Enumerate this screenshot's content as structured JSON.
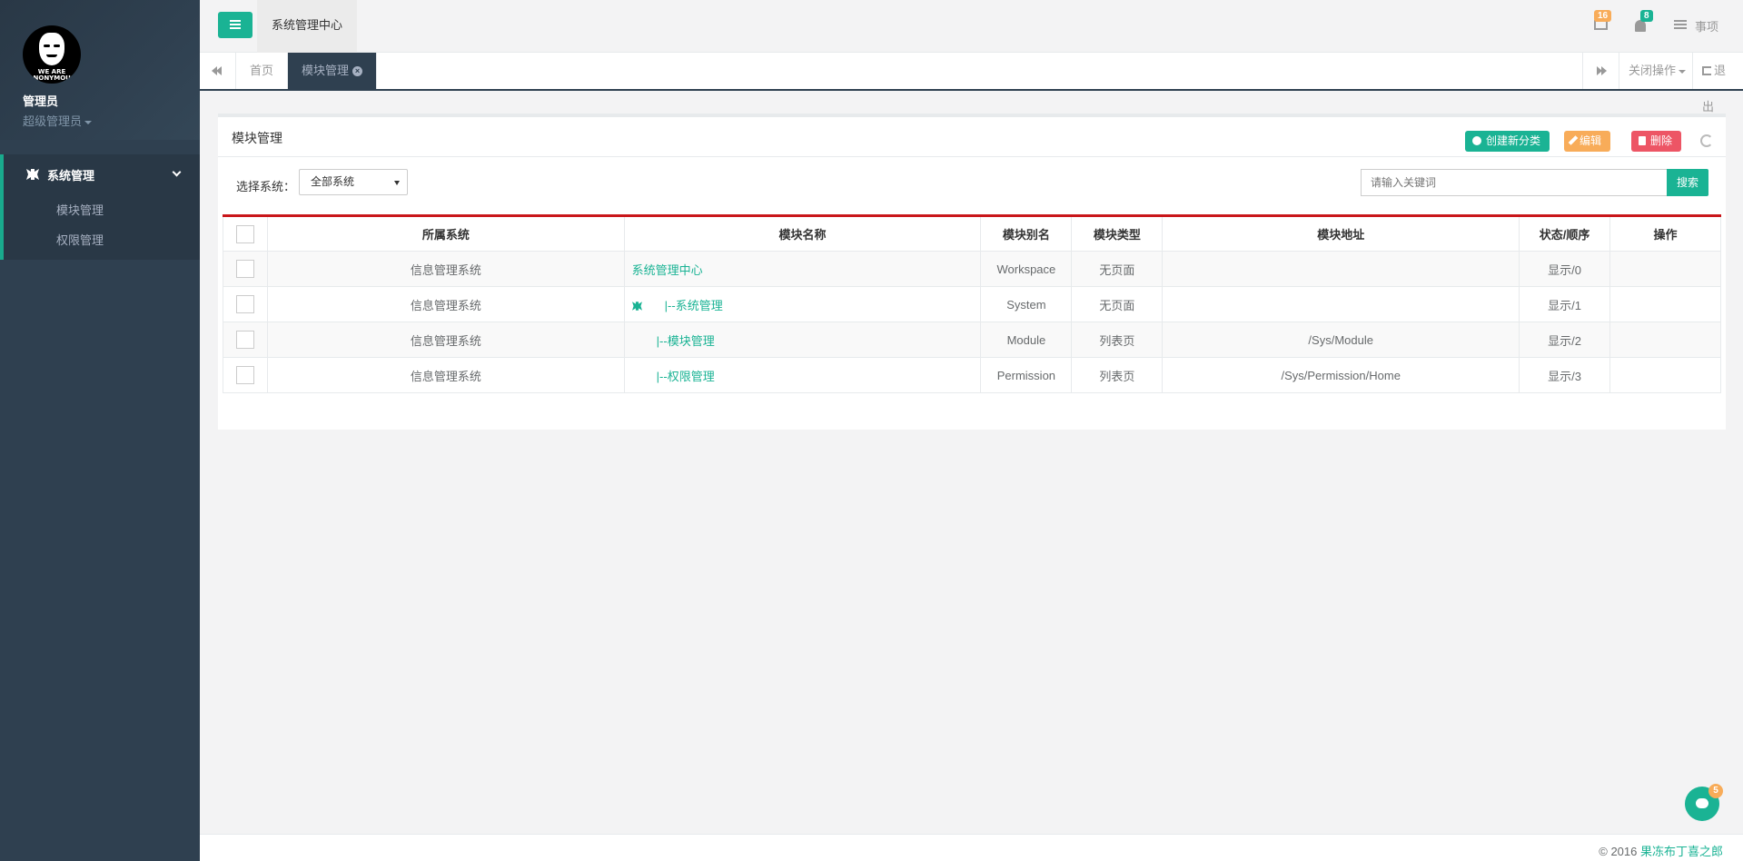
{
  "sidebar": {
    "avatar_text": "WE ARE ANONYMOUS",
    "user_name": "管理员",
    "user_role": "超级管理员",
    "menu": {
      "group_label": "系统管理",
      "items": [
        {
          "label": "模块管理"
        },
        {
          "label": "权限管理"
        }
      ]
    }
  },
  "topbar": {
    "breadcrumb": "系统管理中心",
    "mail_count": "16",
    "alert_count": "8",
    "todo_label": "事项"
  },
  "tabs": {
    "home": "首页",
    "active": "模块管理",
    "close_ops": "关闭操作",
    "logout": "退出"
  },
  "panel": {
    "title": "模块管理",
    "buttons": {
      "create": "创建新分类",
      "edit": "编辑",
      "delete": "删除"
    },
    "filter_label": "选择系统：",
    "filter_value": "全部系统",
    "search_placeholder": "请输入关键词",
    "search_button": "搜索"
  },
  "table": {
    "headers": [
      "所属系统",
      "模块名称",
      "模块别名",
      "模块类型",
      "模块地址",
      "状态/顺序",
      "操作"
    ],
    "rows": [
      {
        "system": "信息管理系统",
        "name": "系统管理中心",
        "alias": "Workspace",
        "type": "无页面",
        "url": "",
        "status": "显示/0",
        "ops": ""
      },
      {
        "system": "信息管理系统",
        "name": "|--系统管理",
        "alias": "System",
        "type": "无页面",
        "url": "",
        "status": "显示/1",
        "ops": ""
      },
      {
        "system": "信息管理系统",
        "name": "|--模块管理",
        "alias": "Module",
        "type": "列表页",
        "url": "/Sys/Module",
        "status": "显示/2",
        "ops": ""
      },
      {
        "system": "信息管理系统",
        "name": "|--权限管理",
        "alias": "Permission",
        "type": "列表页",
        "url": "/Sys/Permission/Home",
        "status": "显示/3",
        "ops": ""
      }
    ]
  },
  "footer": {
    "copyright": "© 2016 ",
    "brand": "果冻布丁喜之郎"
  },
  "chat": {
    "count": "5"
  },
  "colors": {
    "primary": "#1ab394",
    "warning": "#f8ac59",
    "danger": "#ed5565",
    "sidebar": "#2f4050",
    "table_top_border": "#c9161a"
  },
  "icons": [
    "menu-icon",
    "mail-icon",
    "bell-icon",
    "list-icon",
    "plus-circle-icon",
    "pencil-icon",
    "trash-icon",
    "refresh-icon",
    "backward-icon",
    "forward-icon",
    "close-circle-icon",
    "signout-icon",
    "chat-icon",
    "tree-icon"
  ]
}
